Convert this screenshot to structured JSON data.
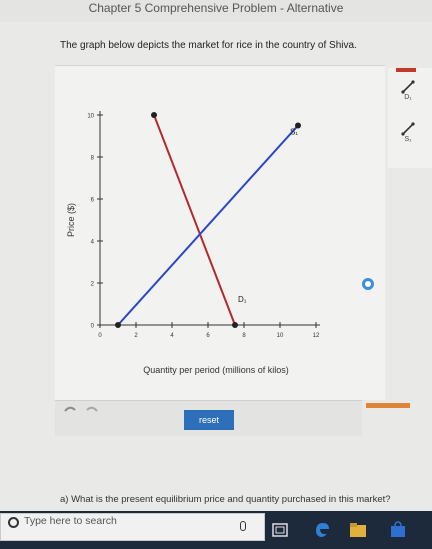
{
  "header": {
    "chapter_title": "Chapter 5 Comprehensive Problem - Alternative"
  },
  "intro_text": "The graph below depicts the market for rice in the country of Shiva.",
  "tools": [
    {
      "label": "D₁",
      "color": "#b5292b"
    },
    {
      "label": "S₁",
      "color": "#2949c8"
    }
  ],
  "chart_data": {
    "type": "line",
    "xlabel": "Quantity per period (millions of kilos)",
    "ylabel": "Price ($)",
    "xlim": [
      0,
      12
    ],
    "ylim": [
      0,
      10
    ],
    "x_ticks": [
      0,
      2,
      4,
      6,
      8,
      10,
      12
    ],
    "y_ticks": [
      0,
      2,
      4,
      6,
      8,
      10
    ],
    "series": [
      {
        "name": "D₁",
        "color": "#b5292b",
        "points": [
          [
            3,
            10
          ],
          [
            7.5,
            0
          ]
        ]
      },
      {
        "name": "S₁",
        "color": "#2949c8",
        "points": [
          [
            1,
            0
          ],
          [
            11,
            9.5
          ]
        ]
      }
    ]
  },
  "controls": {
    "reset_label": "reset"
  },
  "question_text": "a) What is the present equilibrium price and quantity purchased in this market?",
  "taskbar": {
    "search_placeholder": "Type here to search"
  }
}
